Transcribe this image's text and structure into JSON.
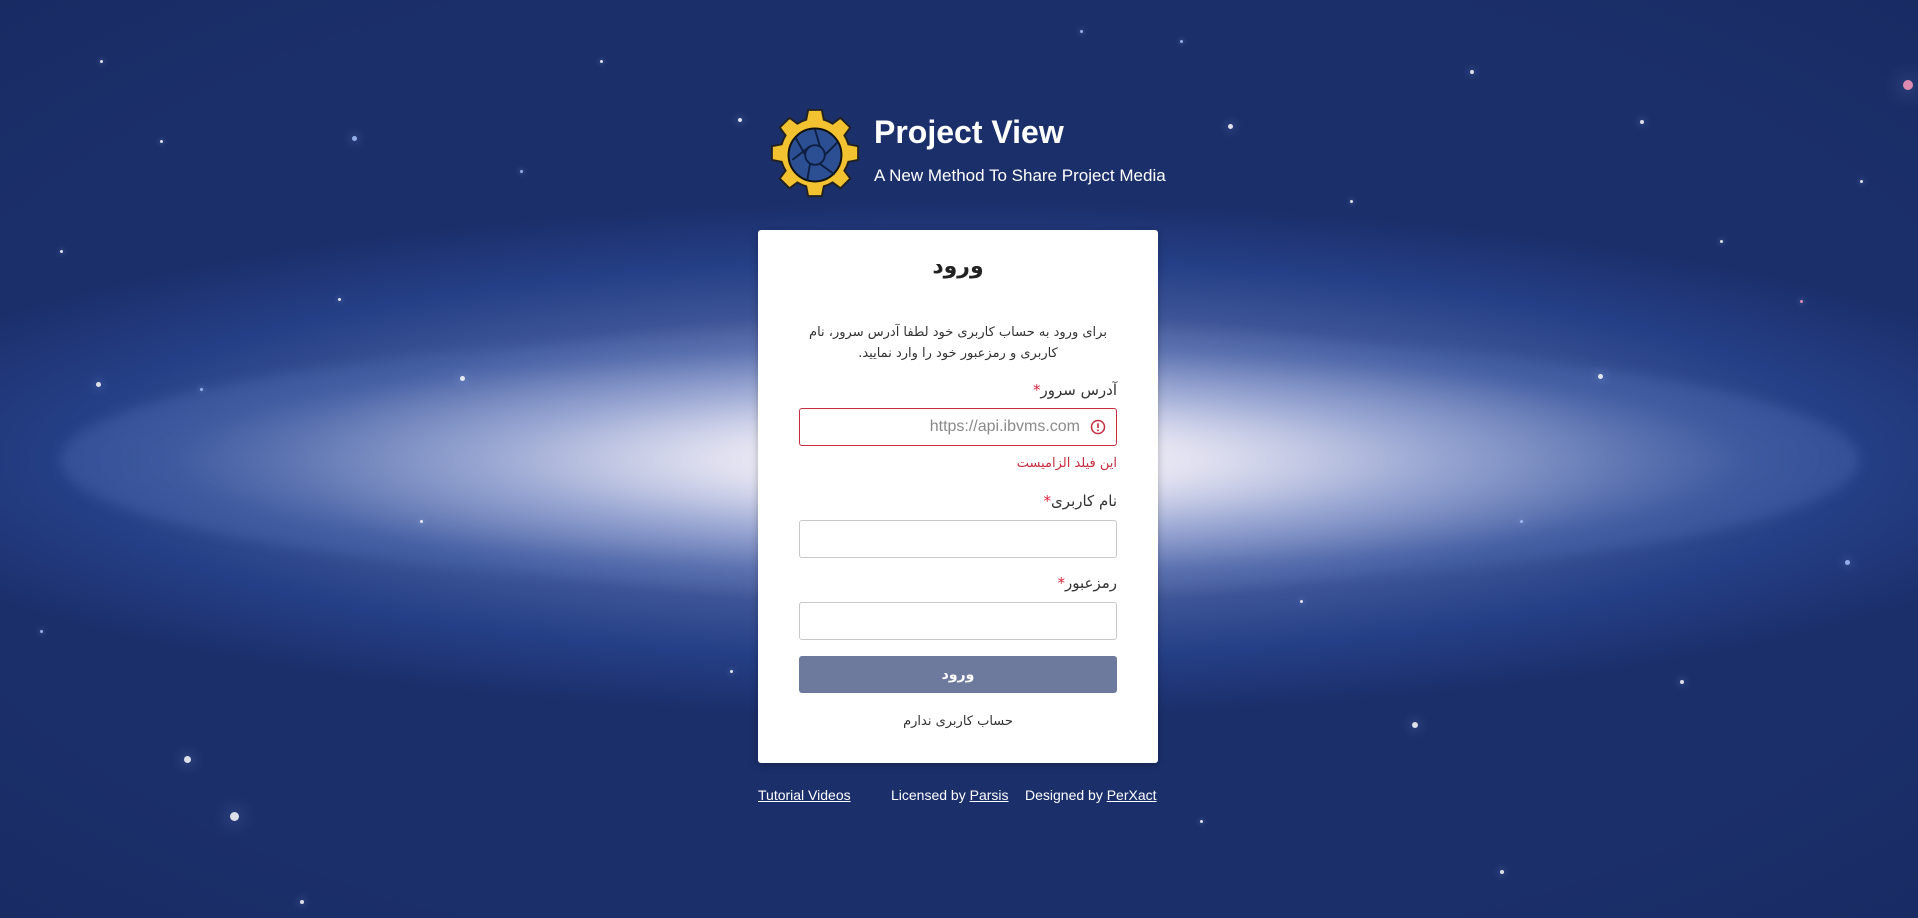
{
  "header": {
    "title": "Project View",
    "subtitle": "A New Method To Share Project Media"
  },
  "card": {
    "title": "ورود",
    "description": "برای ورود به حساب کاربری خود لطفا آدرس سرور، نام کاربری و رمزعبور خود را وارد نمایید.",
    "fields": {
      "server": {
        "label": "آدرس سرور",
        "required_mark": "*",
        "placeholder": "https://api.ibvms.com",
        "value": "",
        "error": "این فیلد الزامیست"
      },
      "username": {
        "label": "نام کاربری",
        "required_mark": "*",
        "value": ""
      },
      "password": {
        "label": "رمزعبور",
        "required_mark": "*",
        "value": ""
      }
    },
    "submit_label": "ورود",
    "no_account_label": "حساب کاربری ندارم"
  },
  "footer": {
    "tutorial_label": "Tutorial Videos",
    "licensed_prefix": "Licensed by",
    "licensed_link": "Parsis",
    "designed_prefix": "Designed by",
    "designed_link": "PerXact"
  },
  "colors": {
    "logo_gear": "#f2c230",
    "logo_center": "#2c4f93",
    "error": "#c62d3f",
    "button": "#6e7a9d"
  },
  "icons": {
    "logo": "gear-camera-aperture-icon",
    "error": "exclamation-circle-icon"
  }
}
